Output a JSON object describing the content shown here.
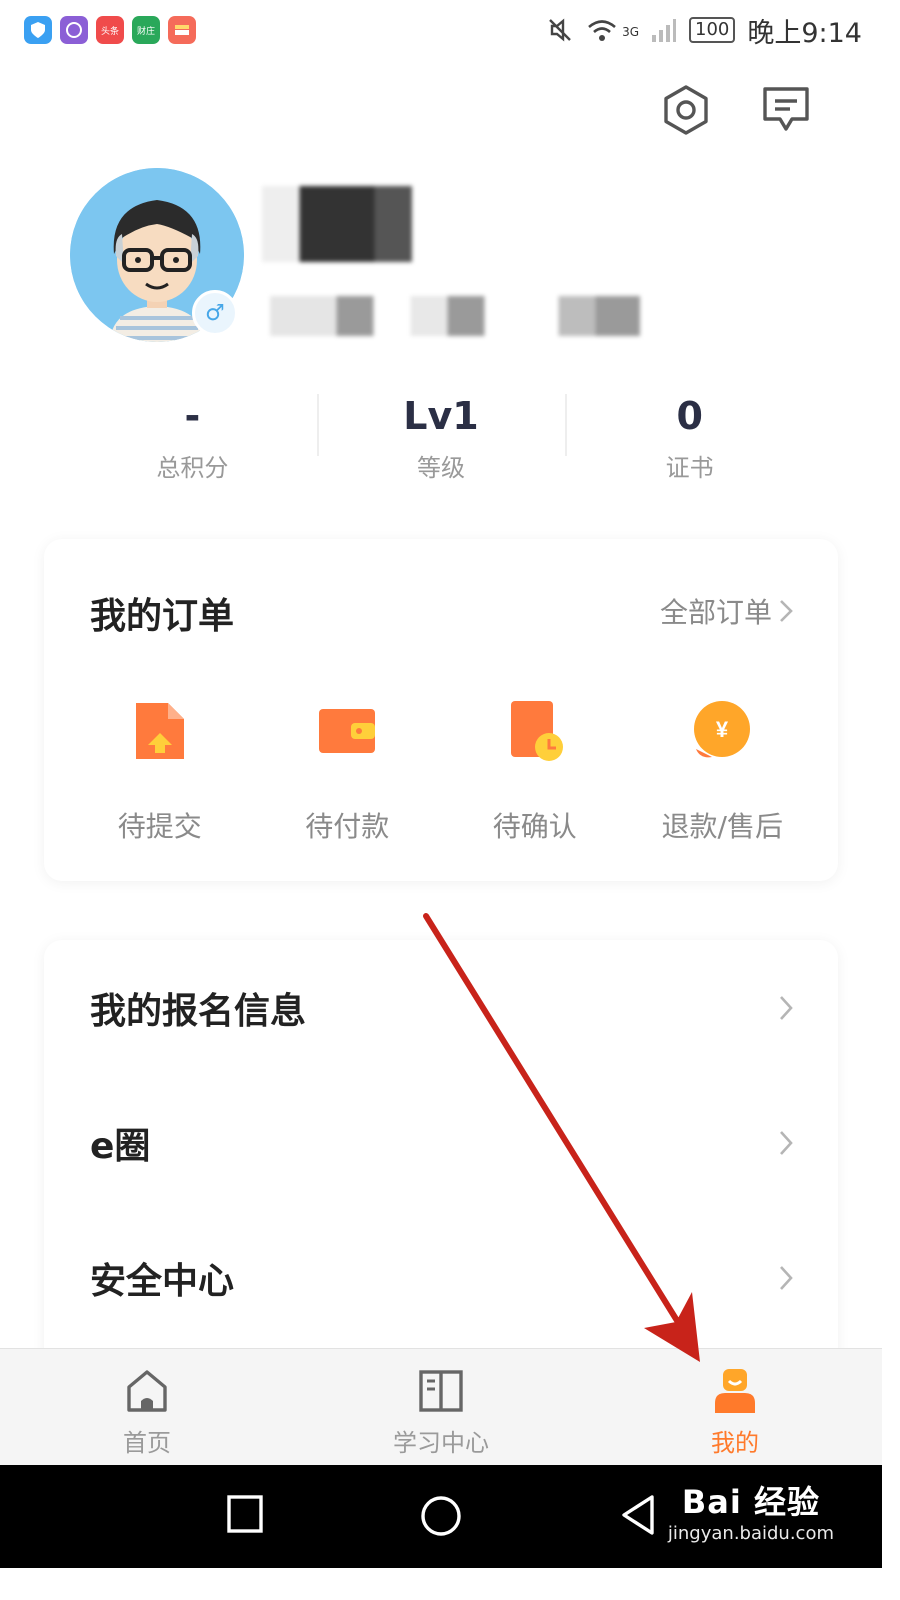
{
  "status_bar": {
    "apps": [
      "头条",
      "财庄"
    ],
    "signal": "3G",
    "battery": "100",
    "time": "晚上9:14"
  },
  "header": {
    "icons": [
      "settings-icon",
      "message-icon"
    ]
  },
  "stats": [
    {
      "value": "-",
      "label": "总积分"
    },
    {
      "value": "Lv1",
      "label": "等级"
    },
    {
      "value": "0",
      "label": "证书"
    }
  ],
  "orders": {
    "title": "我的订单",
    "all_link": "全部订单",
    "items": [
      {
        "label": "待提交",
        "icon": "file-upload-icon"
      },
      {
        "label": "待付款",
        "icon": "wallet-icon"
      },
      {
        "label": "待确认",
        "icon": "doc-clock-icon"
      },
      {
        "label": "退款/售后",
        "icon": "yuan-coin-icon"
      }
    ]
  },
  "menu": [
    {
      "label": "我的报名信息"
    },
    {
      "label": "e圈"
    },
    {
      "label": "安全中心"
    }
  ],
  "tabs": [
    {
      "label": "首页",
      "icon": "home-icon"
    },
    {
      "label": "学习中心",
      "icon": "book-icon"
    },
    {
      "label": "我的",
      "icon": "person-icon"
    }
  ],
  "colors": {
    "accent": "#ff7a2b",
    "arrow": "#c8231a"
  },
  "watermark": {
    "main": "Bai 经验",
    "sub": "jingyan.baidu.com"
  }
}
